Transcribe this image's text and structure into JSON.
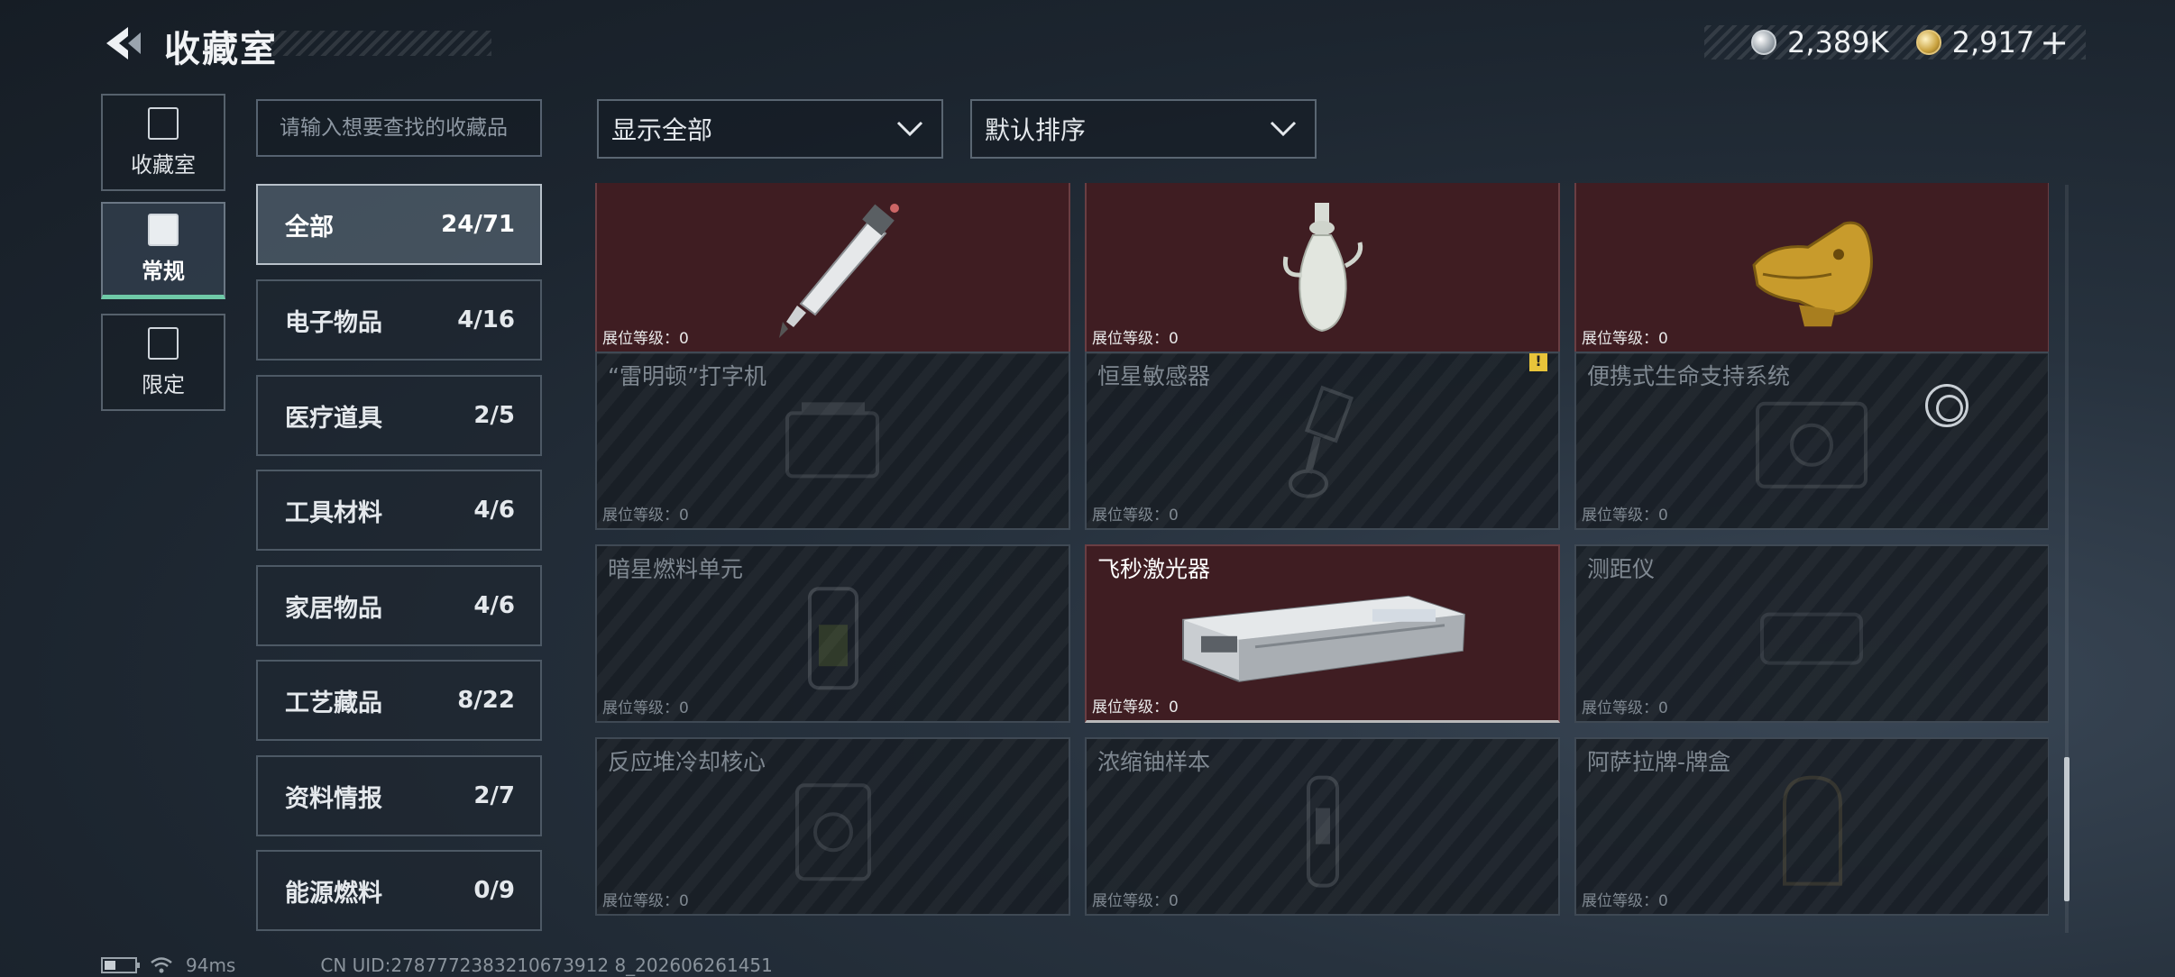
{
  "header": {
    "title": "收藏室",
    "currency": [
      {
        "icon": "silver-coin-icon",
        "value": "2,389K"
      },
      {
        "icon": "gold-coin-icon",
        "value": "2,917",
        "add": "+"
      }
    ]
  },
  "left_nav": [
    {
      "label": "收藏室",
      "icon": "collection-room-icon"
    },
    {
      "label": "常规",
      "icon": "regular-icon",
      "active": true
    },
    {
      "label": "限定",
      "icon": "limited-icon"
    }
  ],
  "search": {
    "placeholder": "请输入想要查找的收藏品"
  },
  "categories": [
    {
      "label": "全部",
      "count": "24/71",
      "active": true
    },
    {
      "label": "电子物品",
      "count": "4/16"
    },
    {
      "label": "医疗道具",
      "count": "2/5"
    },
    {
      "label": "工具材料",
      "count": "4/6"
    },
    {
      "label": "家居物品",
      "count": "4/6"
    },
    {
      "label": "工艺藏品",
      "count": "8/22"
    },
    {
      "label": "资料情报",
      "count": "2/7"
    },
    {
      "label": "能源燃料",
      "count": "0/9"
    }
  ],
  "filters": {
    "filter": "显示全部",
    "sort": "默认排序"
  },
  "items": [
    {
      "name": "",
      "level": "展位等级：0",
      "owned": true,
      "icon": "knife-icon"
    },
    {
      "name": "",
      "level": "展位等级：0",
      "owned": true,
      "icon": "vase-icon"
    },
    {
      "name": "",
      "level": "展位等级：0",
      "owned": true,
      "icon": "golden-head-icon"
    },
    {
      "name": "“雷明顿”打字机",
      "level": "展位等级：0",
      "owned": false,
      "icon": "typewriter-icon"
    },
    {
      "name": "恒星敏感器",
      "level": "展位等级：0",
      "owned": false,
      "icon": "star-sensor-icon",
      "badge": "!"
    },
    {
      "name": "便携式生命支持系统",
      "level": "展位等级：0",
      "owned": false,
      "icon": "life-support-icon"
    },
    {
      "name": "暗星燃料单元",
      "level": "展位等级：0",
      "owned": false,
      "icon": "fuel-cell-icon"
    },
    {
      "name": "飞秒激光器",
      "level": "展位等级：0",
      "owned": true,
      "icon": "femtosecond-laser-icon"
    },
    {
      "name": "测距仪",
      "level": "展位等级：0",
      "owned": false,
      "icon": "rangefinder-icon"
    },
    {
      "name": "反应堆冷却核心",
      "level": "展位等级：0",
      "owned": false,
      "icon": "reactor-core-icon"
    },
    {
      "name": "浓缩铀样本",
      "level": "展位等级：0",
      "owned": false,
      "icon": "uranium-sample-icon"
    },
    {
      "name": "阿萨拉牌-牌盒",
      "level": "展位等级：0",
      "owned": false,
      "icon": "card-box-icon"
    }
  ],
  "status": {
    "ping": "94ms",
    "uid": "CN UID:2787772383210673912 8_202606261451"
  }
}
